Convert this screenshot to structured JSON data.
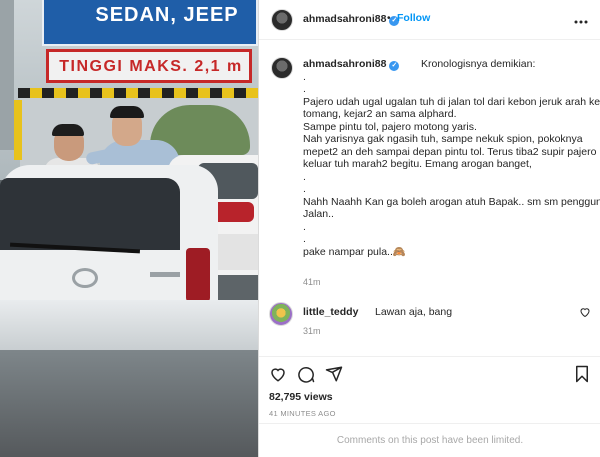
{
  "media": {
    "sign_top": "SEDAN, JEEP",
    "sign_bottom": "TINGGI MAKS. 2,1 m"
  },
  "header": {
    "username": "ahmadsahroni88",
    "separator": "•",
    "follow_label": "Follow",
    "more_icon": "more-horizontal-icon"
  },
  "caption": {
    "username": "ahmadsahroni88",
    "lines": [
      "Kronologisnya demikian:",
      ".",
      ".",
      "Pajero udah ugal ugalan tuh di jalan tol dari kebon jeruk arah ke",
      "tomang, kejar2 an sama alphard.",
      "Sampe pintu tol, pajero motong yaris.",
      "Nah yarisnya gak ngasih tuh, sampe nekuk spion, pokoknya",
      "mepet2 an deh sampai depan pintu tol. Terus tiba2 supir pajero",
      "keluar tuh marah2 begitu. Emang arogan banget,",
      ".",
      ".",
      "Nahh Naahh Kan ga boleh arogan atuh Bapak.. sm sm pengguna",
      "Jalan..",
      ".",
      ".",
      "pake nampar pula..🙈"
    ],
    "time": "41m"
  },
  "comment": {
    "username": "little_teddy",
    "text": "Lawan aja, bang",
    "time": "31m"
  },
  "stats": {
    "views": "82,795 views",
    "time_ago": "41 MINUTES AGO"
  },
  "footer": {
    "limited_text": "Comments on this post have been limited."
  },
  "colors": {
    "accent": "#0095f6",
    "verified": "#3897f0",
    "muted": "#8e8e8e"
  }
}
